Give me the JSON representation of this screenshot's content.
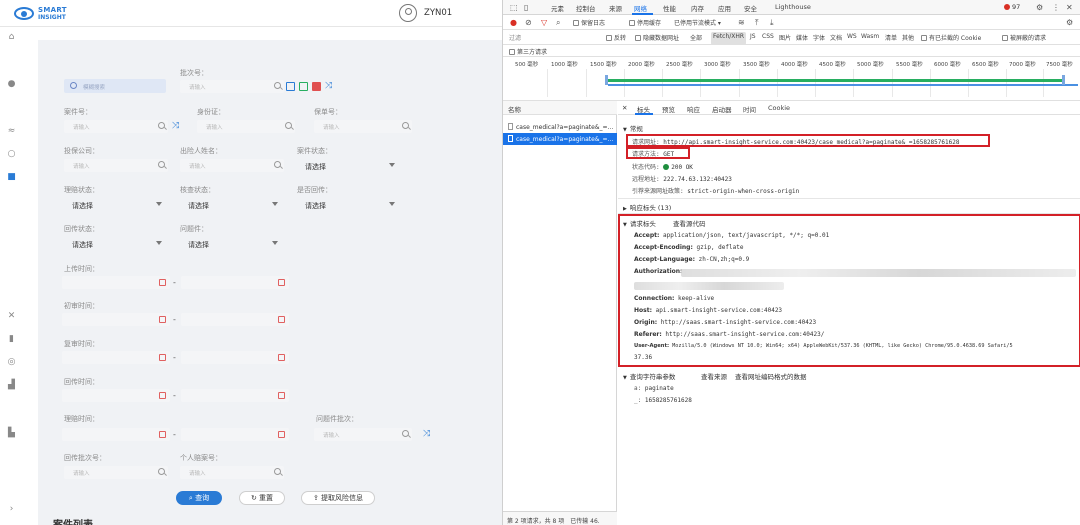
{
  "app": {
    "logo_line1": "SMART",
    "logo_line2": "INSIGHT",
    "user_name": "ZYN01"
  },
  "form": {
    "search_placeholder": "模糊搜索",
    "batch_no": {
      "label": "批次号：",
      "placeholder": "请输入"
    },
    "case_no": {
      "label": "案件号：",
      "placeholder": "请输入"
    },
    "id_card": {
      "label": "身份证：",
      "placeholder": "请输入"
    },
    "policy_no": {
      "label": "保单号：",
      "placeholder": "请输入"
    },
    "insurer": {
      "label": "投保公司：",
      "placeholder": "请输入"
    },
    "insured_name": {
      "label": "出险人姓名：",
      "placeholder": "请输入"
    },
    "case_status": {
      "label": "案件状态：",
      "value": "请选择"
    },
    "claim_status": {
      "label": "理赔状态：",
      "value": "请选择"
    },
    "audit_status": {
      "label": "核查状态：",
      "value": "请选择"
    },
    "is_returned": {
      "label": "是否回传：",
      "value": "请选择"
    },
    "return_status": {
      "label": "回传状态：",
      "value": "请选择"
    },
    "problem_case": {
      "label": "问题件：",
      "value": "请选择"
    },
    "upload_time": {
      "label": "上传时间："
    },
    "first_review_time": {
      "label": "初审时间："
    },
    "second_review_time": {
      "label": "复审时间："
    },
    "return_time": {
      "label": "回传时间："
    },
    "claim_time": {
      "label": "理赔时间："
    },
    "problem_batch": {
      "label": "问题件批次：",
      "placeholder": "请输入"
    },
    "return_batch": {
      "label": "回传批次号：",
      "placeholder": "请输入"
    },
    "personal_account": {
      "label": "个人赔案号：",
      "placeholder": "请输入"
    },
    "date_dash": "-",
    "btn_query": "查询",
    "btn_reset": "重置",
    "btn_extract": "提取风险信息",
    "section_title": "案件列表"
  },
  "devtools": {
    "tabs": [
      "元素",
      "控制台",
      "来源",
      "网络",
      "性能",
      "内存",
      "应用",
      "安全",
      "Lighthouse"
    ],
    "active_tab": "网络",
    "error_count": "97",
    "toolbar": {
      "preserve_log": "保留日志",
      "disable_cache": "停用缓存",
      "throttle": "已停用节流模式"
    },
    "filter": {
      "placeholder": "过滤",
      "invert": "反转",
      "hide_data_urls": "隐藏数据网址",
      "all": "全部",
      "types": [
        "Fetch/XHR",
        "JS",
        "CSS",
        "图片",
        "媒体",
        "字体",
        "文档",
        "WS",
        "Wasm",
        "清单",
        "其他"
      ],
      "blocked_cookies": "有已拦截的 Cookie",
      "blocked_requests": "被屏蔽的请求",
      "third_party": "第三方请求"
    },
    "timeline_ticks": [
      "500 毫秒",
      "1000 毫秒",
      "1500 毫秒",
      "2000 毫秒",
      "2500 毫秒",
      "3000 毫秒",
      "3500 毫秒",
      "4000 毫秒",
      "4500 毫秒",
      "5000 毫秒",
      "5500 毫秒",
      "6000 毫秒",
      "6500 毫秒",
      "7000 毫秒",
      "7500 毫秒"
    ],
    "name_header": "名称",
    "requests": [
      "case_medical?a=paginate&_=...",
      "case_medical?a=paginate&_=..."
    ],
    "status_bar": "第 2 项请求，共 8 项　已传输 46.",
    "detail_tabs": [
      "标头",
      "预览",
      "响应",
      "启动器",
      "时间",
      "Cookie"
    ],
    "general": {
      "title": "常规",
      "url_label": "请求网址:",
      "url": "http://api.smart-insight-service.com:40423/case_medical?a=paginate&_=1658285761628",
      "method_label": "请求方法:",
      "method": "GET",
      "status_label": "状态代码:",
      "status": "200 OK",
      "remote_label": "远程地址:",
      "remote": "222.74.63.132:40423",
      "referrer_label": "引荐来源网址政策:",
      "referrer": "strict-origin-when-cross-origin"
    },
    "response_headers": {
      "title": "响应标头 (13)"
    },
    "request_headers": {
      "title": "请求标头",
      "view_source": "查看源代码",
      "accept_k": "Accept:",
      "accept_v": "application/json, text/javascript, */*; q=0.01",
      "encoding_k": "Accept-Encoding:",
      "encoding_v": "gzip, deflate",
      "language_k": "Accept-Language:",
      "language_v": "zh-CN,zh;q=0.9",
      "auth_k": "Authorization:",
      "connection_k": "Connection:",
      "connection_v": "keep-alive",
      "host_k": "Host:",
      "host_v": "api.smart-insight-service.com:40423",
      "origin_k": "Origin:",
      "origin_v": "http://saas.smart-insight-service.com:40423",
      "referer_k": "Referer:",
      "referer_v": "http://saas.smart-insight-service.com:40423/",
      "ua_k": "User-Agent:",
      "ua_v": "Mozilla/5.0 (Windows NT 10.0; Win64; x64) AppleWebKit/537.36 (KHTML, like Gecko) Chrome/95.0.4638.69 Safari/5",
      "ua_v2": "37.36"
    },
    "query_params": {
      "title": "查询字符串参数",
      "view_source": "查看来源",
      "view_decoded": "查看网址编码格式的数据",
      "a_k": "a:",
      "a_v": "paginate",
      "ts_k": "_:",
      "ts_v": "1658285761628"
    }
  }
}
